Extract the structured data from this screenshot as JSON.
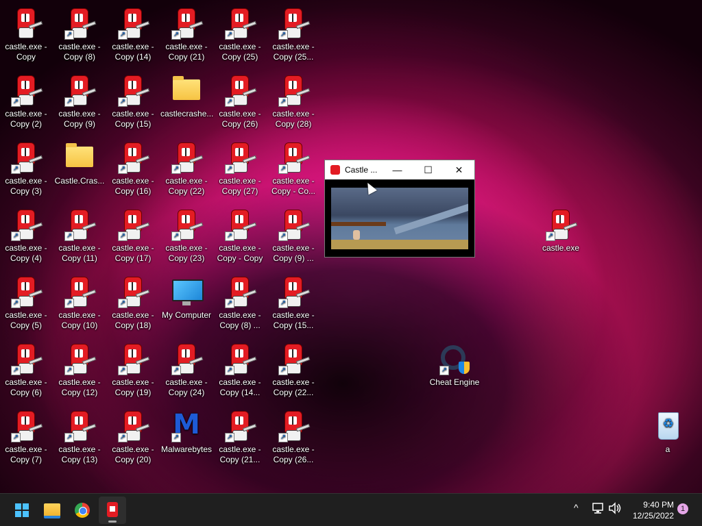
{
  "desktop": {
    "icons": [
      {
        "label": "castle.exe -\nCopy"
      },
      {
        "label": "castle.exe -\nCopy (8)"
      },
      {
        "label": "castle.exe -\nCopy (14)"
      },
      {
        "label": "castle.exe -\nCopy (21)"
      },
      {
        "label": "castle.exe -\nCopy (25)"
      },
      {
        "label": "castle.exe -\nCopy (25..."
      },
      {
        "label": "castle.exe -\nCopy (2)"
      },
      {
        "label": "castle.exe -\nCopy (9)"
      },
      {
        "label": "castle.exe -\nCopy (15)"
      },
      {
        "label": "castlecrashe..."
      },
      {
        "label": "castle.exe -\nCopy (26)"
      },
      {
        "label": "castle.exe -\nCopy (28)"
      },
      {
        "label": "castle.exe -\nCopy (3)"
      },
      {
        "label": "Castle.Cras..."
      },
      {
        "label": "castle.exe -\nCopy (16)"
      },
      {
        "label": "castle.exe -\nCopy (22)"
      },
      {
        "label": "castle.exe -\nCopy (27)"
      },
      {
        "label": "castle.exe -\nCopy - Co..."
      },
      {
        "label": "castle.exe -\nCopy (4)"
      },
      {
        "label": "castle.exe -\nCopy (11)"
      },
      {
        "label": "castle.exe -\nCopy (17)"
      },
      {
        "label": "castle.exe -\nCopy (23)"
      },
      {
        "label": "castle.exe -\nCopy - Copy"
      },
      {
        "label": "castle.exe -\nCopy (9) ..."
      },
      {
        "label": "castle.exe -\nCopy (5)"
      },
      {
        "label": "castle.exe -\nCopy (10)"
      },
      {
        "label": "castle.exe -\nCopy (18)"
      },
      {
        "label": "My Computer"
      },
      {
        "label": "castle.exe -\nCopy (8) ..."
      },
      {
        "label": "castle.exe -\nCopy (15..."
      },
      {
        "label": "castle.exe -\nCopy (6)"
      },
      {
        "label": "castle.exe -\nCopy (12)"
      },
      {
        "label": "castle.exe -\nCopy (19)"
      },
      {
        "label": "castle.exe -\nCopy (24)"
      },
      {
        "label": "castle.exe -\nCopy (14..."
      },
      {
        "label": "castle.exe -\nCopy (22..."
      },
      {
        "label": "castle.exe -\nCopy (7)"
      },
      {
        "label": "castle.exe -\nCopy (13)"
      },
      {
        "label": "castle.exe -\nCopy (20)"
      },
      {
        "label": "Malwarebytes"
      },
      {
        "label": "castle.exe -\nCopy (21..."
      },
      {
        "label": "castle.exe -\nCopy (26..."
      }
    ],
    "castle_exe": "castle.exe",
    "cheat_engine": "Cheat Engine",
    "recycle_bin": "a"
  },
  "game_window": {
    "title": "Castle ...",
    "minimize": "—",
    "maximize": "☐",
    "close": "✕"
  },
  "taskbar": {
    "time": "9:40 PM",
    "date": "12/25/2022",
    "notification_count": "1",
    "chevron": "^"
  }
}
